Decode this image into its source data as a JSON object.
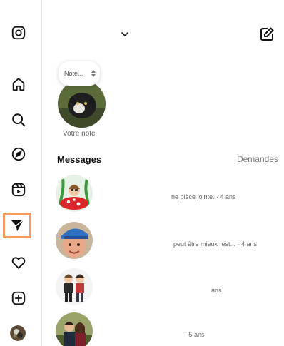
{
  "header": {
    "account_name": "",
    "compose_icon": "pencil-square-icon"
  },
  "rail": {
    "items": [
      {
        "icon": "instagram-icon"
      },
      {
        "icon": "home-icon"
      },
      {
        "icon": "search-icon"
      },
      {
        "icon": "explore-icon"
      },
      {
        "icon": "reels-icon"
      },
      {
        "icon": "direct-icon",
        "active": true
      },
      {
        "icon": "heart-icon"
      },
      {
        "icon": "create-icon"
      }
    ],
    "highlight_color": "#f39a5c"
  },
  "notes": {
    "input_placeholder": "Note...",
    "caption": "Votre note"
  },
  "messages_section": {
    "title": "Messages",
    "requests_label": "Demandes"
  },
  "conversations": [
    {
      "name": "",
      "preview": "ne pièce jointe. · 4 ans"
    },
    {
      "name": "",
      "preview": "peut être mieux rest... · 4 ans"
    },
    {
      "name": "",
      "preview": "ans"
    },
    {
      "name": "",
      "preview": "· 5 ans"
    }
  ]
}
